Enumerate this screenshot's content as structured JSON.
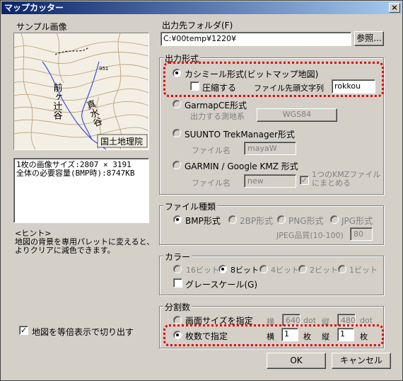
{
  "window": {
    "title": "マップカッター",
    "close_glyph": "×"
  },
  "sample": {
    "label": "サンプル画像",
    "map": {
      "elevation": "951",
      "place1": "前ヶ辻谷",
      "place2": "真水谷",
      "watermark": "国土地理院"
    },
    "info_lines": [
      "1枚の画像サイズ:2807 × 3191",
      "全体の必要容量(BMP時):8747KB"
    ],
    "hint": [
      "<ヒント>",
      "地図の背景を専用パレットに変えると、",
      "よりクリアに減色できます。"
    ]
  },
  "same_scale": {
    "label": "地図を等倍表示で切り出す",
    "checked": true
  },
  "output_folder": {
    "label": "出力先フォルダ(F)",
    "value": "C:¥00temp¥1220¥",
    "browse": "参照..."
  },
  "output_format": {
    "title": "出力形式",
    "kashmir": {
      "label": "カシミール形式(ビットマップ地図)",
      "selected": true,
      "compress": "圧縮する",
      "prefix_label": "ファイル先頭文字列",
      "prefix_value": "rokkou"
    },
    "garmin_mapce": {
      "label": "GarmapCE形式",
      "datum_label": "出力する測地系",
      "datum_value": "WGS84"
    },
    "suunto": {
      "label": "SUUNTO TrekManager形式",
      "file_label": "ファイル名",
      "file_value": "mayaW"
    },
    "garmin_kmz": {
      "label": "GARMIN / Google KMZ 形式",
      "file_label": "ファイル名",
      "file_value": "new",
      "merge_label_1": "1つのKMZファイル",
      "merge_label_2": "にまとめる"
    }
  },
  "file_type": {
    "title": "ファイル種類",
    "options": [
      "BMP形式",
      "2BP形式",
      "PNG形式",
      "JPG形式"
    ],
    "selected": "BMP形式",
    "jpeg_quality_label": "JPEG品質(10-100)",
    "jpeg_quality_value": "80"
  },
  "color": {
    "title": "カラー",
    "options": [
      "16ビット",
      "8ビット",
      "4ビット",
      "2ビット",
      "1ビット"
    ],
    "selected": "8ビット",
    "grayscale": "グレースケール(G)"
  },
  "split": {
    "title": "分割数",
    "by_screen": "画面サイズを指定",
    "by_count": "枚数で指定",
    "selected": "by_count",
    "width_label": "横",
    "height_label": "縦",
    "width_px": "640",
    "height_px": "480",
    "dot": "dot",
    "count_w": "1",
    "count_h": "1",
    "sheet": "枚"
  },
  "buttons": {
    "ok": "OK",
    "cancel": "キャンセル"
  },
  "colors": {
    "title_start": "#0a246a",
    "title_end": "#a6caf0",
    "highlight": "#e00000",
    "face": "#d4d0c8"
  }
}
